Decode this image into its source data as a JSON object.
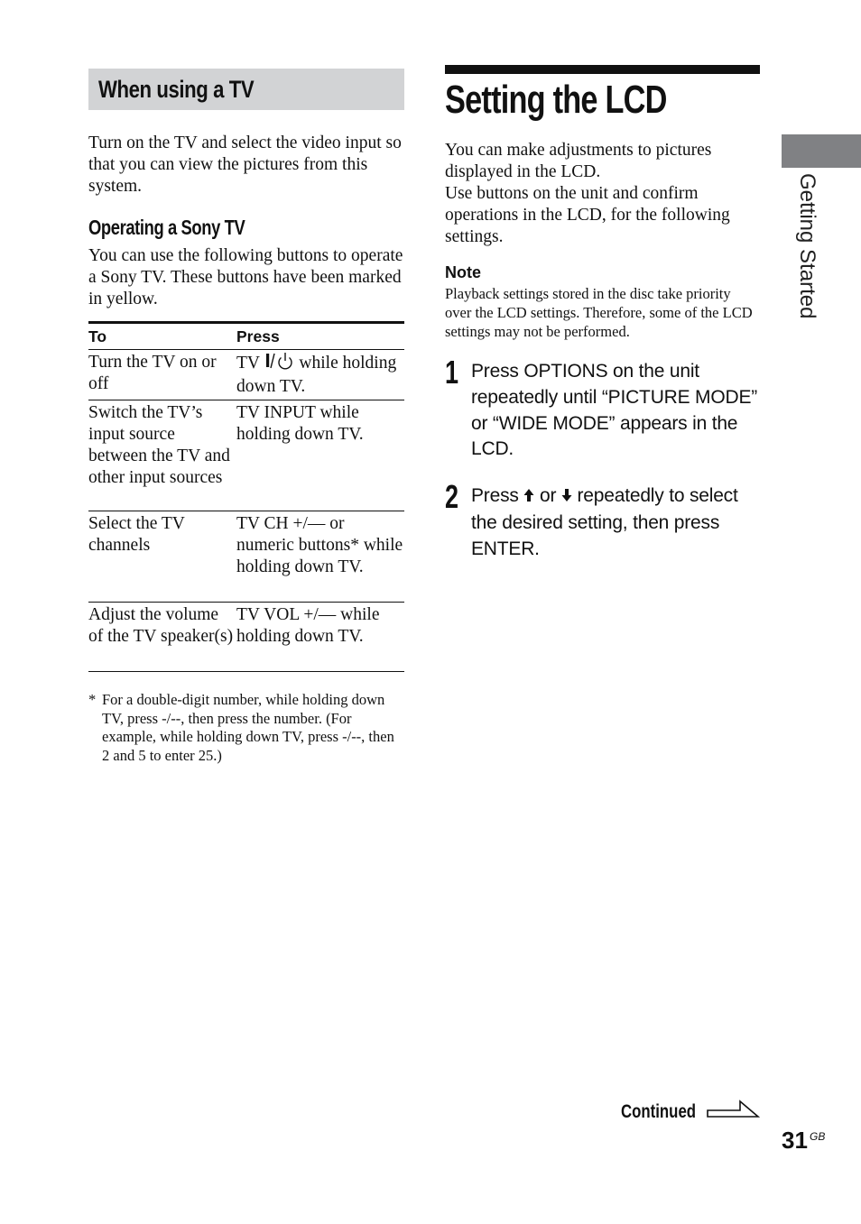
{
  "left": {
    "section_title": "When using a TV",
    "intro": "Turn on the TV and select the video input so that you can view the pictures from this system.",
    "sub_heading": "Operating a Sony TV",
    "sub_body": "You can use the following buttons to operate a Sony TV. These buttons have been marked in yellow.",
    "table": {
      "headers": [
        "To",
        "Press"
      ],
      "rows": [
        {
          "to": "Turn the TV on or off",
          "press_prefix": "TV ",
          "press_icon": "power-toggle-icon",
          "press_suffix": " while holding down TV."
        },
        {
          "to": "Switch the TV’s input source between the TV and other input sources",
          "press": "TV INPUT while holding down TV."
        },
        {
          "to": "Select the TV channels",
          "press": "TV CH +/— or numeric buttons* while holding down TV."
        },
        {
          "to": "Adjust the volume of the TV speaker(s)",
          "press": "TV VOL +/— while holding down TV."
        }
      ]
    },
    "footnote_marker": "*",
    "footnote": "For a double-digit number, while holding down TV, press -/--, then press the number. (For example, while holding down TV, press -/--, then 2 and 5 to enter 25.)"
  },
  "right": {
    "title": "Setting the LCD",
    "intro_1": "You can make adjustments to pictures displayed in the LCD.",
    "intro_2": "Use buttons on the unit and confirm operations in the LCD, for the following settings.",
    "note_label": "Note",
    "note_text": "Playback settings stored in the disc take priority over the LCD settings. Therefore, some of the LCD settings may not be performed.",
    "steps": [
      {
        "num": "1",
        "text": "Press OPTIONS on the unit repeatedly until “PICTURE MODE” or “WIDE MODE” appears in the LCD."
      },
      {
        "num": "2",
        "text_a": "Press ",
        "up_icon": "up-arrow-icon",
        "text_b": " or ",
        "down_icon": "down-arrow-icon",
        "text_c": " repeatedly to select the desired setting, then press ENTER."
      }
    ]
  },
  "side_tab": {
    "label": "Getting Started",
    "color": "#808184"
  },
  "footer": {
    "continued": "Continued",
    "page_number": "31",
    "page_suffix": "GB"
  },
  "colors": {
    "section_header_bg": "#d2d3d5",
    "text": "#111111"
  }
}
